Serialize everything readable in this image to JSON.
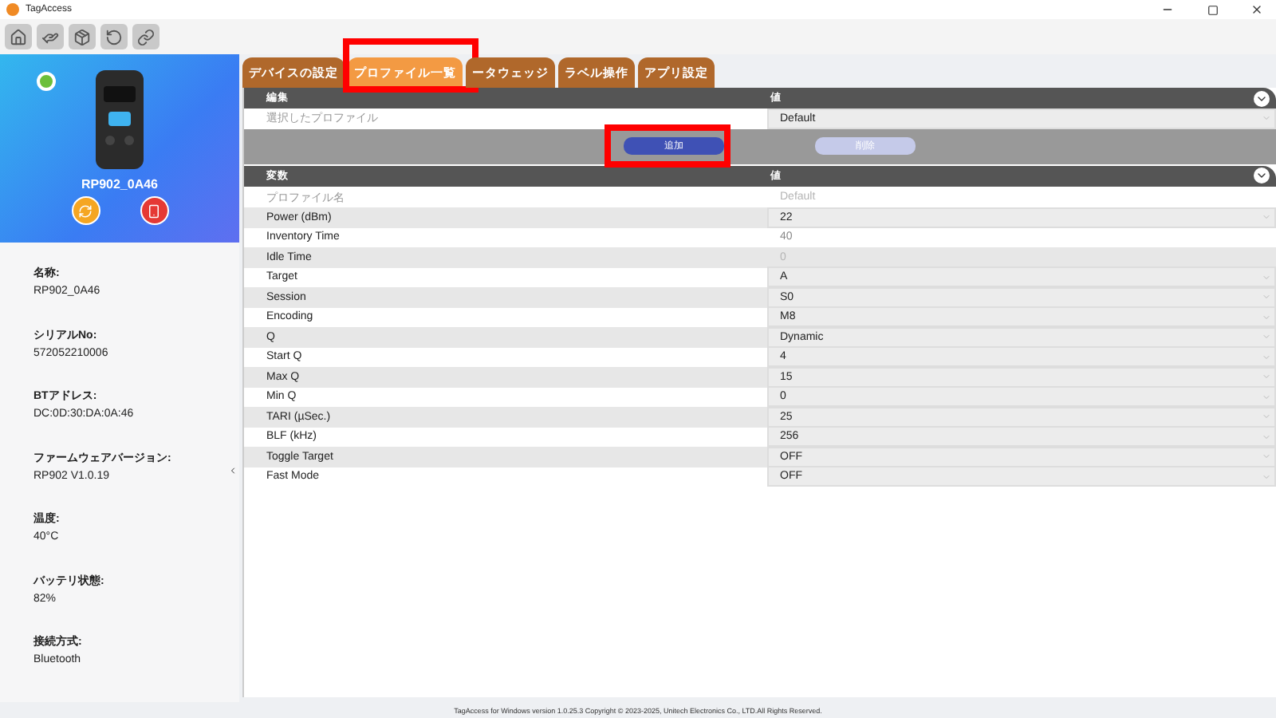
{
  "window": {
    "title": "TagAccess"
  },
  "device": {
    "name": "RP902_0A46",
    "color": "#6cbf3a"
  },
  "info": [
    {
      "label": "名称:",
      "value": "RP902_0A46"
    },
    {
      "label": "シリアルNo:",
      "value": "572052210006"
    },
    {
      "label": "BTアドレス:",
      "value": "DC:0D:30:DA:0A:46"
    },
    {
      "label": "ファームウェアバージョン:",
      "value": "RP902 V1.0.19"
    },
    {
      "label": "温度:",
      "value": "40°C"
    },
    {
      "label": "バッテリ状態:",
      "value": "82%"
    },
    {
      "label": "接続方式:",
      "value": "Bluetooth"
    }
  ],
  "tabs": [
    {
      "label": "デバイスの設定",
      "selected": false,
      "highlighted": false
    },
    {
      "label": "プロファイル一覧",
      "selected": true,
      "highlighted": true
    },
    {
      "label": "ータウェッジ",
      "selected": false,
      "highlighted": false
    },
    {
      "label": "ラベル操作",
      "selected": false,
      "highlighted": false
    },
    {
      "label": "アプリ設定",
      "selected": false,
      "highlighted": false
    }
  ],
  "edit_section": {
    "columns": [
      "編集",
      "値"
    ],
    "row": {
      "label": "選択したプロファイル",
      "value": "Default"
    },
    "buttons": [
      {
        "label": "追加",
        "disabled": false,
        "highlighted": true
      },
      {
        "label": "削除",
        "disabled": true,
        "highlighted": false
      }
    ]
  },
  "variables": {
    "columns": [
      "変数",
      "値"
    ],
    "rows": [
      {
        "label": "プロファイル名",
        "value": "Default",
        "kind": "name",
        "disabled": true
      },
      {
        "label": "Power (dBm)",
        "value": "22",
        "kind": "select"
      },
      {
        "label": "Inventory Time",
        "value": "40",
        "kind": "text",
        "disabled": false
      },
      {
        "label": "Idle Time",
        "value": "0",
        "kind": "text",
        "disabled": true
      },
      {
        "label": "Target",
        "value": "A",
        "kind": "select"
      },
      {
        "label": "Session",
        "value": "S0",
        "kind": "select"
      },
      {
        "label": "Encoding",
        "value": "M8",
        "kind": "select"
      },
      {
        "label": "Q",
        "value": "Dynamic",
        "kind": "select"
      },
      {
        "label": "Start Q",
        "value": "4",
        "kind": "select"
      },
      {
        "label": "Max Q",
        "value": "15",
        "kind": "select"
      },
      {
        "label": "Min Q",
        "value": "0",
        "kind": "select"
      },
      {
        "label": "TARI (µSec.)",
        "value": "25",
        "kind": "select"
      },
      {
        "label": "BLF (kHz)",
        "value": "256",
        "kind": "select"
      },
      {
        "label": "Toggle Target",
        "value": "OFF",
        "kind": "select"
      },
      {
        "label": "Fast Mode",
        "value": "OFF",
        "kind": "select"
      }
    ]
  },
  "footer": "TagAccess for Windows version 1.0.25.3 Copyright © 2023-2025, Unitech Electronics Co., LTD.All Rights Reserved."
}
